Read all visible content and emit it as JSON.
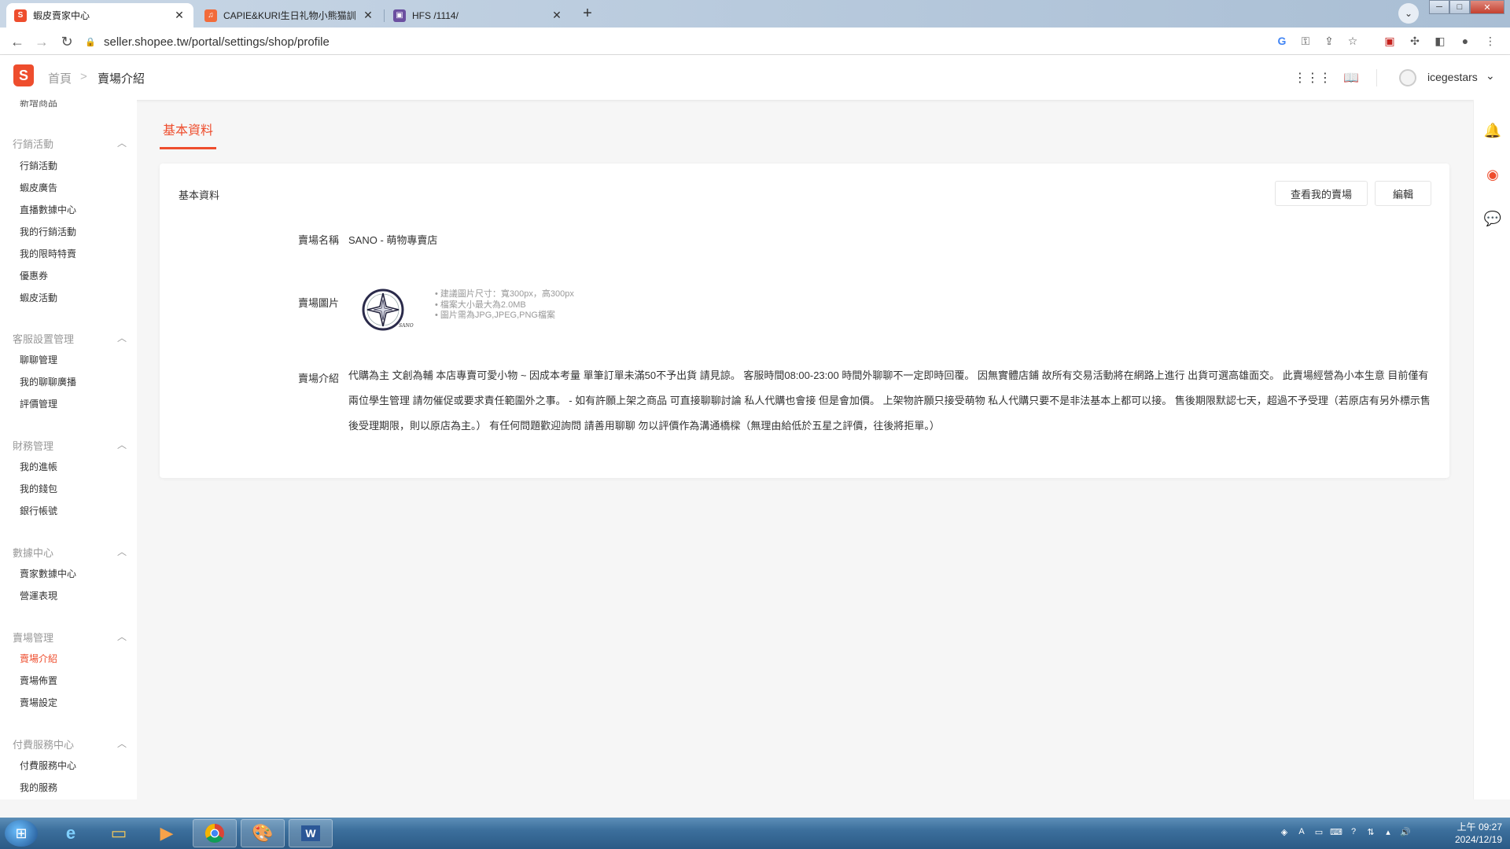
{
  "browser": {
    "tabs": [
      {
        "title": "蝦皮賣家中心",
        "favicon": "S",
        "favicon_color": "#ee4d2d",
        "active": true
      },
      {
        "title": "CAPIE&KURI生日礼物小熊猫訓",
        "favicon": "♫",
        "favicon_color": "#f26b3a",
        "active": false
      },
      {
        "title": "HFS /1114/",
        "favicon": "▣",
        "favicon_color": "#6b4fa0",
        "active": false
      }
    ],
    "url": "seller.shopee.tw/portal/settings/shop/profile"
  },
  "header": {
    "logo": "S",
    "breadcrumb_home": "首頁",
    "breadcrumb_separator": ">",
    "breadcrumb_current": "賣場介紹",
    "username": "icegestars"
  },
  "sidebar": {
    "cut_item": "新增商品",
    "groups": [
      {
        "title": "行銷活動",
        "items": [
          "行銷活動",
          "蝦皮廣告",
          "直播數據中心",
          "我的行銷活動",
          "我的限時特賣",
          "優惠券",
          "蝦皮活動"
        ]
      },
      {
        "title": "客服設置管理",
        "items": [
          "聊聊管理",
          "我的聊聊廣播",
          "評價管理"
        ]
      },
      {
        "title": "財務管理",
        "items": [
          "我的進帳",
          "我的錢包",
          "銀行帳號"
        ]
      },
      {
        "title": "數據中心",
        "items": [
          "賣家數據中心",
          "營運表現"
        ]
      },
      {
        "title": "賣場管理",
        "items": [
          "賣場介紹",
          "賣場佈置",
          "賣場設定"
        ]
      },
      {
        "title": "付費服務中心",
        "items": [
          "付費服務中心",
          "我的服務"
        ]
      }
    ],
    "active_item": "賣場介紹"
  },
  "main": {
    "tab_label": "基本資料",
    "card_title": "基本資料",
    "view_shop_button": "查看我的賣場",
    "edit_button": "編輯",
    "shop_name_label": "賣場名稱",
    "shop_name": "SANO - 萌物專賣店",
    "shop_image_label": "賣場圖片",
    "image_hints": [
      "• 建議圖片尺寸：寬300px，高300px",
      "• 檔案大小最大為2.0MB",
      "• 圖片需為JPG,JPEG,PNG檔案"
    ],
    "description_label": "賣場介紹",
    "description": "代購為主 文創為輔 本店專賣可愛小物 ~ 因成本考量 單筆訂單未滿50不予出貨 請見諒。 客服時間08:00-23:00 時間外聊聊不一定即時回覆。 因無實體店鋪 故所有交易活動將在網路上進行 出貨可選高雄面交。 此賣場經營為小本生意 目前僅有兩位學生管理 請勿催促或要求責任範圍外之事。 - 如有許願上架之商品 可直接聊聊討論 私人代購也會接 但是會加價。 上架物許願只接受萌物 私人代購只要不是非法基本上都可以接。 售後期限默認七天，超過不予受理（若原店有另外標示售後受理期限，則以原店為主。） 有任何問題歡迎詢問 請善用聊聊 勿以評價作為溝通橋樑（無理由給低於五星之評價，往後將拒單。）"
  },
  "taskbar": {
    "time": "上午 09:27",
    "date": "2024/12/19"
  },
  "colors": {
    "brand": "#ee4d2d"
  }
}
